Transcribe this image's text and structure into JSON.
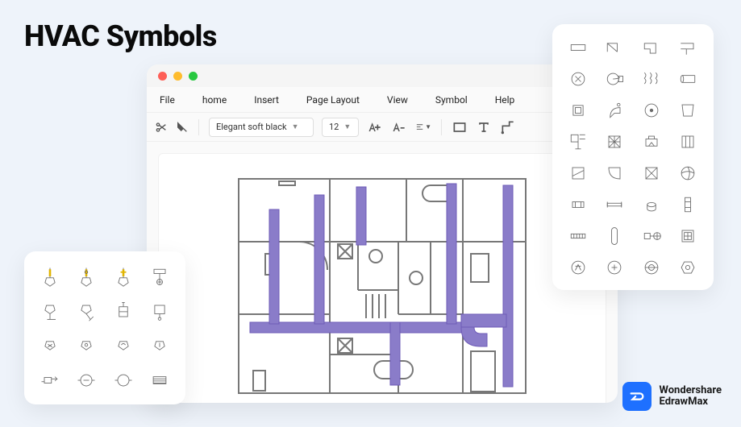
{
  "title": "HVAC Symbols",
  "menu": {
    "file": "File",
    "home": "home",
    "insert": "Insert",
    "page_layout": "Page Layout",
    "view": "View",
    "symbol": "Symbol",
    "help": "Help"
  },
  "toolbar": {
    "font_name": "Elegant soft black",
    "font_size": "12"
  },
  "brand": {
    "line1": "Wondershare",
    "line2": "EdrawMax"
  },
  "colors": {
    "duct": "#6e5bb7",
    "duct_fill": "#8a7cc9",
    "symbol_stroke": "#6a6a6a",
    "symbol_yellow": "#e0b400"
  }
}
